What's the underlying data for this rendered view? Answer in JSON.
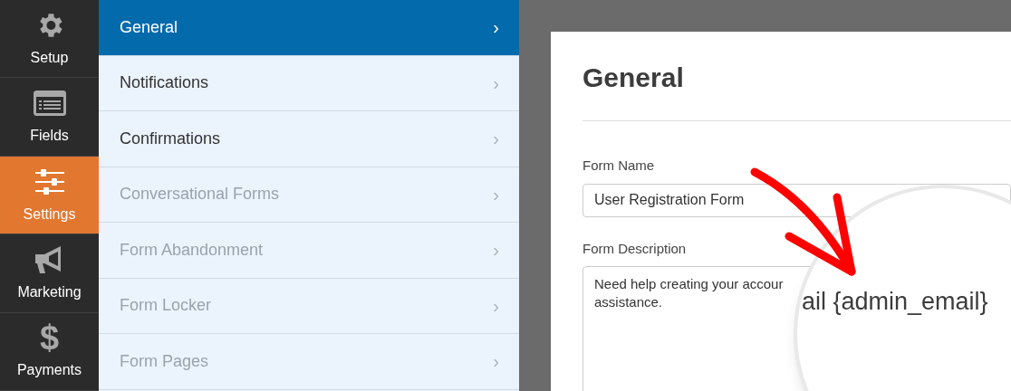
{
  "main_nav": [
    {
      "label": "Setup",
      "selected": false
    },
    {
      "label": "Fields",
      "selected": false
    },
    {
      "label": "Settings",
      "selected": true
    },
    {
      "label": "Marketing",
      "selected": false
    },
    {
      "label": "Payments",
      "glyph": "$",
      "selected": false
    }
  ],
  "settings_nav": [
    {
      "label": "General",
      "chevron": "›",
      "selected": true,
      "disabled": false
    },
    {
      "label": "Notifications",
      "chevron": "›",
      "selected": false,
      "disabled": false
    },
    {
      "label": "Confirmations",
      "chevron": "›",
      "selected": false,
      "disabled": false
    },
    {
      "label": "Conversational Forms",
      "chevron": "›",
      "selected": false,
      "disabled": true
    },
    {
      "label": "Form Abandonment",
      "chevron": "›",
      "selected": false,
      "disabled": true
    },
    {
      "label": "Form Locker",
      "chevron": "›",
      "selected": false,
      "disabled": true
    },
    {
      "label": "Form Pages",
      "chevron": "›",
      "selected": false,
      "disabled": true
    }
  ],
  "panel": {
    "title": "General",
    "fields": [
      {
        "kind": "input",
        "label": "Form Name",
        "value": "User Registration Form"
      },
      {
        "kind": "textarea",
        "label": "Form Description",
        "value": "Need help creating your accour\nassistance."
      }
    ]
  },
  "magnifier": {
    "text": "ail {admin_email}"
  }
}
